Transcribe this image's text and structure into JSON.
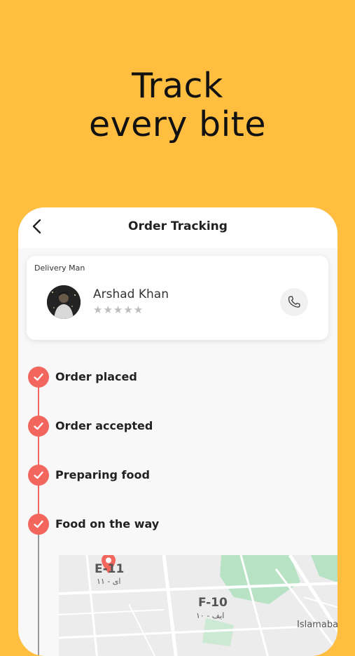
{
  "headline": {
    "line1": "Track",
    "line2": "every bite"
  },
  "header": {
    "title": "Order Tracking"
  },
  "delivery": {
    "label": "Delivery Man",
    "name": "Arshad Khan",
    "stars": "★★★★★",
    "rating": 0
  },
  "steps": [
    {
      "label": "Order placed"
    },
    {
      "label": "Order accepted"
    },
    {
      "label": "Preparing food"
    },
    {
      "label": "Food on the way"
    }
  ],
  "map": {
    "sector1": "E-11",
    "sector1_urdu": "ای - ١١",
    "sector2": "F-10",
    "sector2_urdu": "ایف - ١٠",
    "city": "Islamaba"
  },
  "colors": {
    "background": "#FFBE3F",
    "accent": "#F2665E",
    "map_green": "#B7E2C4"
  }
}
